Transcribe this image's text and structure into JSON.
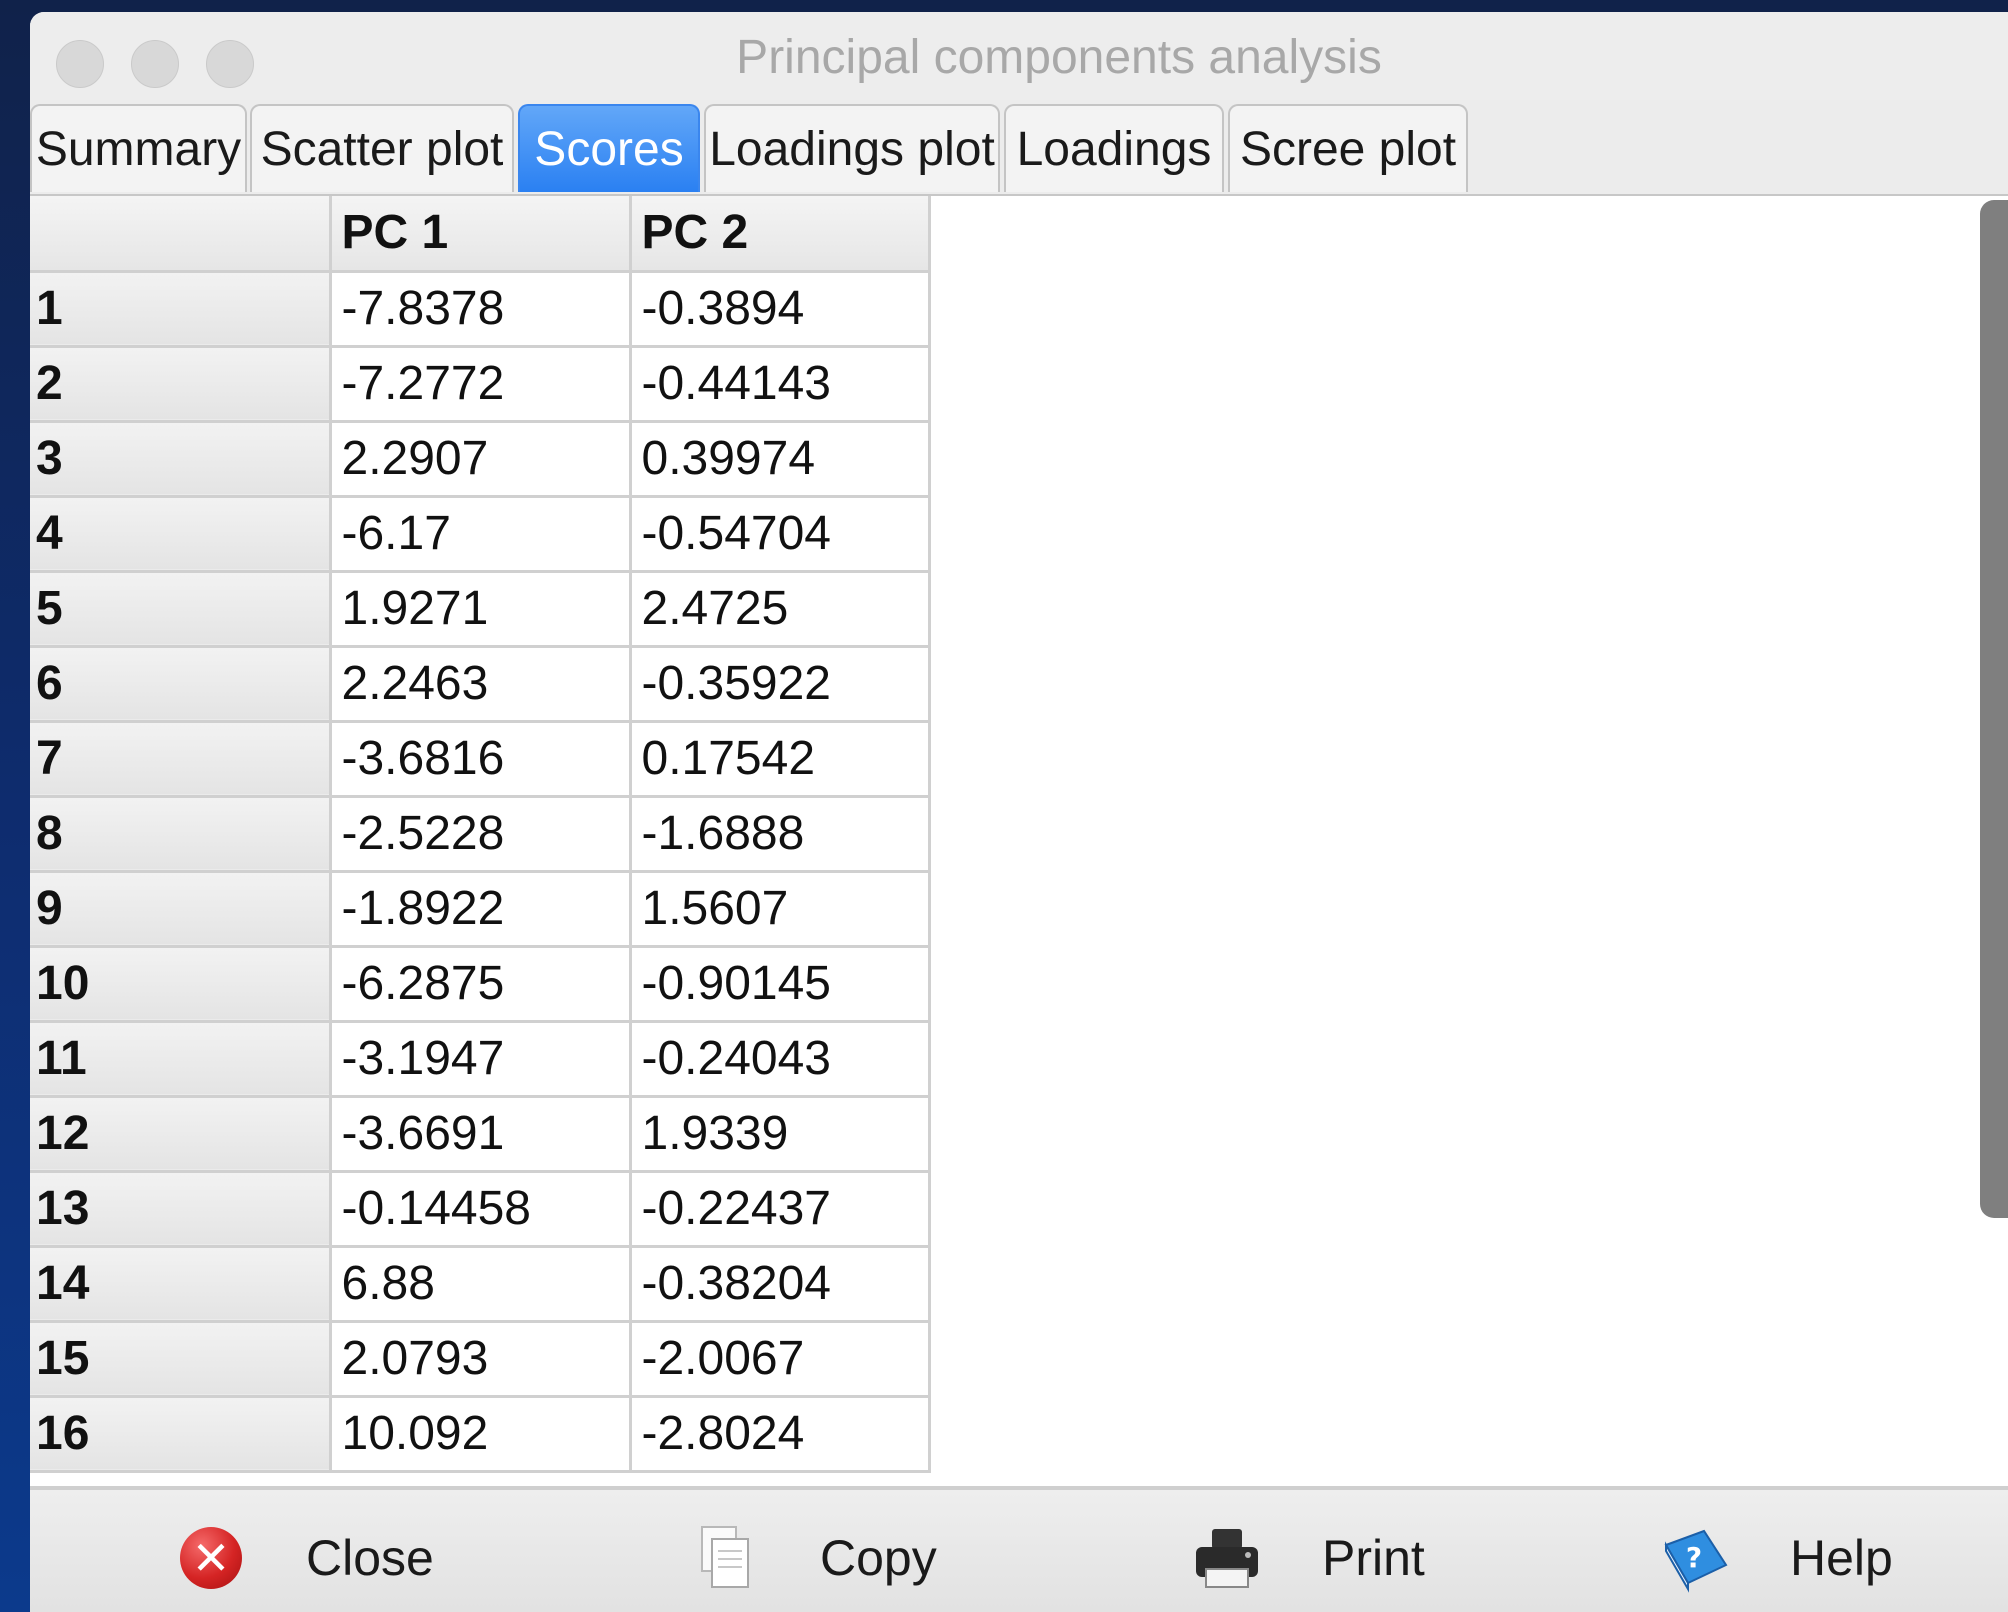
{
  "window": {
    "title": "Principal components analysis"
  },
  "tabs": [
    {
      "label": "Summary",
      "active": false
    },
    {
      "label": "Scatter plot",
      "active": false
    },
    {
      "label": "Scores",
      "active": true
    },
    {
      "label": "Loadings plot",
      "active": false
    },
    {
      "label": "Loadings",
      "active": false
    },
    {
      "label": "Scree plot",
      "active": false
    }
  ],
  "table": {
    "corner": "",
    "columns": [
      "PC 1",
      "PC 2"
    ],
    "rows": [
      {
        "label": "1",
        "cells": [
          "-7.8378",
          "-0.3894"
        ]
      },
      {
        "label": "2",
        "cells": [
          "-7.2772",
          "-0.44143"
        ]
      },
      {
        "label": "3",
        "cells": [
          "2.2907",
          "0.39974"
        ]
      },
      {
        "label": "4",
        "cells": [
          "-6.17",
          "-0.54704"
        ]
      },
      {
        "label": "5",
        "cells": [
          "1.9271",
          "2.4725"
        ]
      },
      {
        "label": "6",
        "cells": [
          "2.2463",
          "-0.35922"
        ]
      },
      {
        "label": "7",
        "cells": [
          "-3.6816",
          "0.17542"
        ]
      },
      {
        "label": "8",
        "cells": [
          "-2.5228",
          "-1.6888"
        ]
      },
      {
        "label": "9",
        "cells": [
          "-1.8922",
          "1.5607"
        ]
      },
      {
        "label": "10",
        "cells": [
          "-6.2875",
          "-0.90145"
        ]
      },
      {
        "label": "11",
        "cells": [
          "-3.1947",
          "-0.24043"
        ]
      },
      {
        "label": "12",
        "cells": [
          "-3.6691",
          "1.9339"
        ]
      },
      {
        "label": "13",
        "cells": [
          "-0.14458",
          "-0.22437"
        ]
      },
      {
        "label": "14",
        "cells": [
          "6.88",
          "-0.38204"
        ]
      },
      {
        "label": "15",
        "cells": [
          "2.0793",
          "-2.0067"
        ]
      },
      {
        "label": "16",
        "cells": [
          "10.092",
          "-2.8024"
        ]
      }
    ]
  },
  "buttons": {
    "close": {
      "label": "Close",
      "icon": "close-icon"
    },
    "copy": {
      "label": "Copy",
      "icon": "copy-icon"
    },
    "print": {
      "label": "Print",
      "icon": "printer-icon"
    },
    "help": {
      "label": "Help",
      "icon": "help-book-icon"
    }
  },
  "colors": {
    "active_tab": "#2a80f2",
    "desktop": "#0e2c6e",
    "close_icon": "#d52424"
  }
}
